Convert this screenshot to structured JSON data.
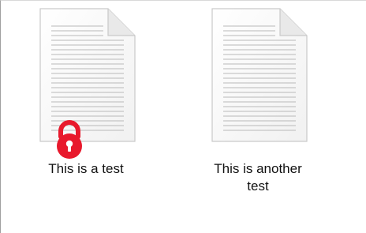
{
  "explorer": {
    "files": [
      {
        "name": "This is a test",
        "icon": "text-document-icon",
        "overlay": "padlock-icon",
        "overlay_color": "#e8192c"
      },
      {
        "name": "This is another test",
        "icon": "text-document-icon"
      }
    ]
  }
}
